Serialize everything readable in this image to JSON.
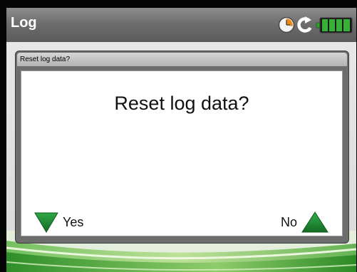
{
  "window": {
    "title": "Log"
  },
  "status": {
    "icons": [
      "clock-icon",
      "refresh-icon",
      "battery-icon"
    ],
    "battery_color": "#2f9e2f"
  },
  "dialog": {
    "header": "Reset log data?",
    "message": "Reset log data?",
    "yes_label": "Yes",
    "no_label": "No",
    "yes_icon": "down-triangle-icon",
    "no_icon": "up-triangle-icon",
    "accent_color": "#1f8a2e"
  }
}
